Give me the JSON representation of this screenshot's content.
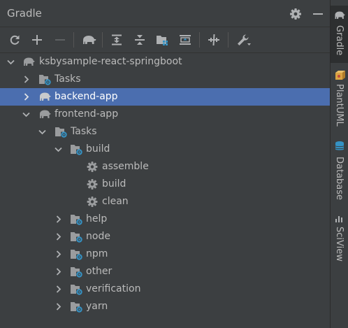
{
  "panel": {
    "title": "Gradle"
  },
  "toolbar": {
    "buttons": [
      "reload-icon",
      "add-icon",
      "remove-icon",
      "gradle-elephant-icon",
      "expand-all-icon",
      "collapse-all-icon",
      "group-modules-icon",
      "show-dependencies-icon",
      "toggle-offline-icon",
      "settings-wrench-icon"
    ]
  },
  "tree": {
    "root": "ksbysample-react-springboot",
    "root_tasks": "Tasks",
    "backend": "backend-app",
    "frontend": "frontend-app",
    "frontend_tasks": "Tasks",
    "build_group": "build",
    "build_tasks": [
      "assemble",
      "build",
      "clean"
    ],
    "other_groups": [
      "help",
      "node",
      "npm",
      "other",
      "verification",
      "yarn"
    ]
  },
  "right_rail": [
    "Gradle",
    "PlantUML",
    "Database",
    "SciView"
  ],
  "colors": {
    "background": "#3c3f41",
    "selection": "#4b6eaf",
    "folder_accent": "#3592c4",
    "text": "#bbbbbb"
  }
}
